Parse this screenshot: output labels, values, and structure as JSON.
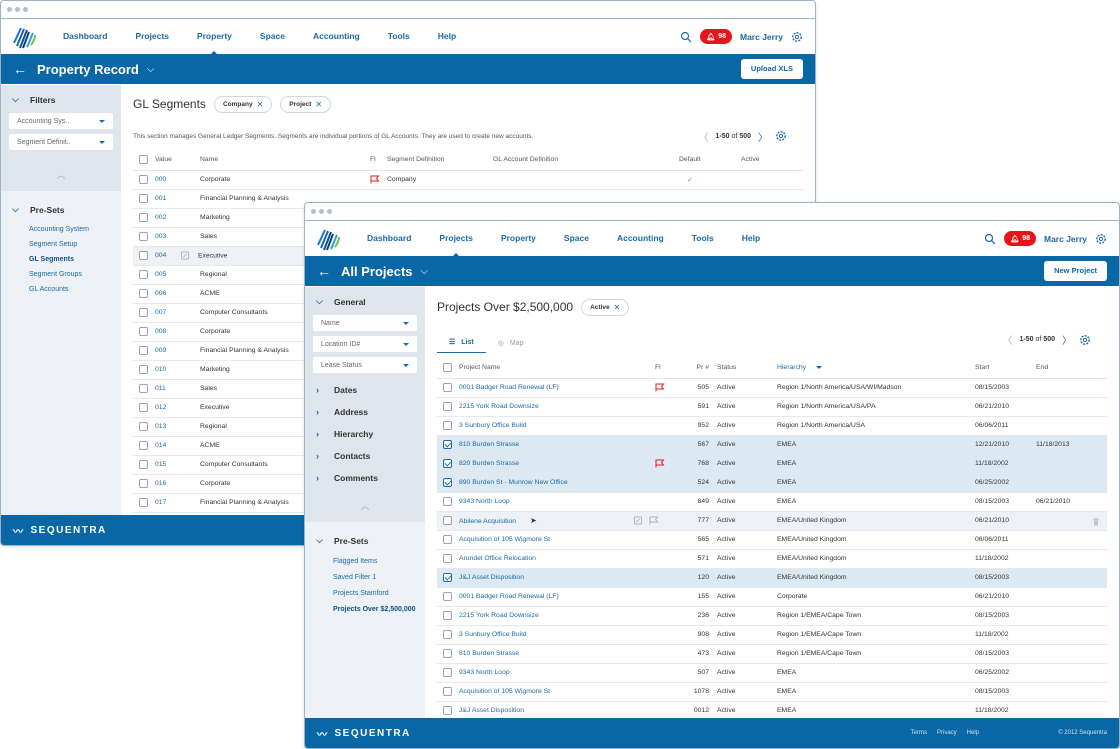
{
  "nav": {
    "items": [
      "Dashboard",
      "Projects",
      "Property",
      "Space",
      "Accounting",
      "Tools",
      "Help"
    ],
    "notifications": "98",
    "user": "Marc Jerry"
  },
  "w1": {
    "active_nav": "Property",
    "page_title": "Property Record",
    "action_button": "Upload XLS",
    "sidebar": {
      "filters_label": "Filters",
      "selects": [
        "Accounting Sys..",
        "Segment Definit.."
      ],
      "presets_label": "Pre-Sets",
      "presets": [
        {
          "label": "Accounting  System",
          "active": false
        },
        {
          "label": "Segment Setup",
          "active": false
        },
        {
          "label": "GL Segments",
          "active": true
        },
        {
          "label": "Segment Groups",
          "active": false
        },
        {
          "label": "GL Accounts",
          "active": false
        }
      ]
    },
    "main": {
      "title": "GL Segments",
      "chips": [
        "Company",
        "Project"
      ],
      "description": "This section manages General Ledger Segments. Segments are individual portions of GL Accounts. They are used to create new accounts.",
      "pager": {
        "range": "1-50",
        "of": "of",
        "total": "500"
      },
      "columns": [
        "Value",
        "Name",
        "Fl",
        "Segment Definition",
        "GL Account Definition",
        "Default",
        "Active"
      ],
      "rows": [
        {
          "value": "000",
          "name": "Corporate",
          "flag": true,
          "segment": "Company",
          "default": true
        },
        {
          "value": "001",
          "name": "Financial Planning & Analysis"
        },
        {
          "value": "002",
          "name": "Marketing"
        },
        {
          "value": "003",
          "name": "Sales"
        },
        {
          "value": "004",
          "name": "Executive",
          "hover": true
        },
        {
          "value": "005",
          "name": "Regional"
        },
        {
          "value": "006",
          "name": "ACME"
        },
        {
          "value": "007",
          "name": "Computer Consultants"
        },
        {
          "value": "008",
          "name": "Corporate"
        },
        {
          "value": "009",
          "name": "Financial Planning & Analysis"
        },
        {
          "value": "010",
          "name": "Marketing"
        },
        {
          "value": "011",
          "name": "Sales"
        },
        {
          "value": "012",
          "name": "Executive"
        },
        {
          "value": "013",
          "name": "Regional"
        },
        {
          "value": "014",
          "name": "ACME"
        },
        {
          "value": "015",
          "name": "Computer Consultants"
        },
        {
          "value": "016",
          "name": "Corporate"
        },
        {
          "value": "017",
          "name": "Financial Planning & Analysis"
        }
      ]
    },
    "footer_brand": "SEQUENTRA"
  },
  "w2": {
    "active_nav": "Projects",
    "page_title": "All Projects",
    "action_button": "New Project",
    "sidebar": {
      "general_label": "General",
      "selects": [
        "Name",
        "Location ID#",
        "Lease Status"
      ],
      "groups": [
        "Dates",
        "Address",
        "Hierarchy",
        "Contacts",
        "Comments"
      ],
      "presets_label": "Pre-Sets",
      "presets": [
        {
          "label": "Flagged Items",
          "active": false
        },
        {
          "label": "Saved Filter 1",
          "active": false
        },
        {
          "label": "Projects Stamford",
          "active": false
        },
        {
          "label": "Projects Over $2,500,000",
          "active": true
        }
      ]
    },
    "main": {
      "title": "Projects Over $2,500,000",
      "chips": [
        "Active"
      ],
      "tabs": [
        "List",
        "Map"
      ],
      "pager": {
        "range": "1-50",
        "of": "of",
        "total": "500"
      },
      "columns": [
        "Project Name",
        "Fl",
        "Pr #",
        "Status",
        "Hierarchy",
        "Start",
        "End"
      ],
      "rows": [
        {
          "name": "0001 Badger Road Renewal (LF)",
          "flag": true,
          "pr": "505",
          "status": "Active",
          "hier": "Region 1/North America/USA/WI/Madson",
          "start": "08/15/2003",
          "end": ""
        },
        {
          "name": "2215 York Road Downsize",
          "pr": "591",
          "status": "Active",
          "hier": "Region 1/North America/USA/PA",
          "start": "06/21/2010",
          "end": ""
        },
        {
          "name": "3 Sunbury Office Build",
          "pr": "952",
          "status": "Active",
          "hier": "Region 1/North America/USA",
          "start": "06/06/2011",
          "end": ""
        },
        {
          "name": "810 Burden Strasse",
          "checked": true,
          "pr": "567",
          "status": "Active",
          "hier": "EMEA",
          "start": "12/21/2010",
          "end": "11/18/2013"
        },
        {
          "name": "820 Burden Strasse",
          "checked": true,
          "flag": true,
          "pr": "768",
          "status": "Active",
          "hier": "EMEA",
          "start": "11/18/2002",
          "end": ""
        },
        {
          "name": "890 Burden St - Munrow New Office",
          "checked": true,
          "pr": "524",
          "status": "Active",
          "hier": "EMEA",
          "start": "06/25/2002",
          "end": ""
        },
        {
          "name": "9343 North Loop",
          "pr": "849",
          "status": "Active",
          "hier": "EMEA",
          "start": "08/15/2003",
          "end": "06/21/2010"
        },
        {
          "name": "Abilene Acquisition",
          "hover": true,
          "pr": "777",
          "status": "Active",
          "hier": "EMEA/United Kingdom",
          "start": "06/21/2010",
          "end": ""
        },
        {
          "name": "Acquisition of 105 Wigmore St",
          "pr": "565",
          "status": "Active",
          "hier": "EMEA/United Kingdom",
          "start": "06/06/2011",
          "end": ""
        },
        {
          "name": "Arundel Office Relocation",
          "pr": "571",
          "status": "Active",
          "hier": "EMEA/United Kingdom",
          "start": "11/18/2002",
          "end": ""
        },
        {
          "name": "J&J Asset Disposition",
          "checked": true,
          "pr": "120",
          "status": "Active",
          "hier": "EMEA/United Kingdom",
          "start": "08/15/2003",
          "end": ""
        },
        {
          "name": "0001 Badger Road Renewal (LF)",
          "pr": "155",
          "status": "Active",
          "hier": "Corporate",
          "start": "06/21/2010",
          "end": ""
        },
        {
          "name": "2215 York Road Downsize",
          "pr": "236",
          "status": "Active",
          "hier": "Region 1/EMEA/Cape Town",
          "start": "08/15/2003",
          "end": ""
        },
        {
          "name": "3 Sunbury Office Build",
          "pr": "908",
          "status": "Active",
          "hier": "Region 1/EMEA/Cape Town",
          "start": "11/18/2002",
          "end": ""
        },
        {
          "name": "810 Burden Strasse",
          "pr": "473",
          "status": "Active",
          "hier": "Region 1/EMEA/Cape Town",
          "start": "08/15/2003",
          "end": ""
        },
        {
          "name": "9343 North Loop",
          "pr": "507",
          "status": "Active",
          "hier": "EMEA",
          "start": "06/25/2002",
          "end": ""
        },
        {
          "name": "Acquisition of 105 Wigmore St",
          "pr": "1078",
          "status": "Active",
          "hier": "EMEA",
          "start": "08/15/2003",
          "end": ""
        },
        {
          "name": "J&J Asset Disposition",
          "pr": "0012",
          "status": "Active",
          "hier": "EMEA",
          "start": "11/18/2002",
          "end": ""
        }
      ]
    },
    "footer": {
      "brand": "SEQUENTRA",
      "links": [
        "Terms",
        "Privacy",
        "Help"
      ],
      "copyright": "© 2012 Sequentra"
    }
  }
}
